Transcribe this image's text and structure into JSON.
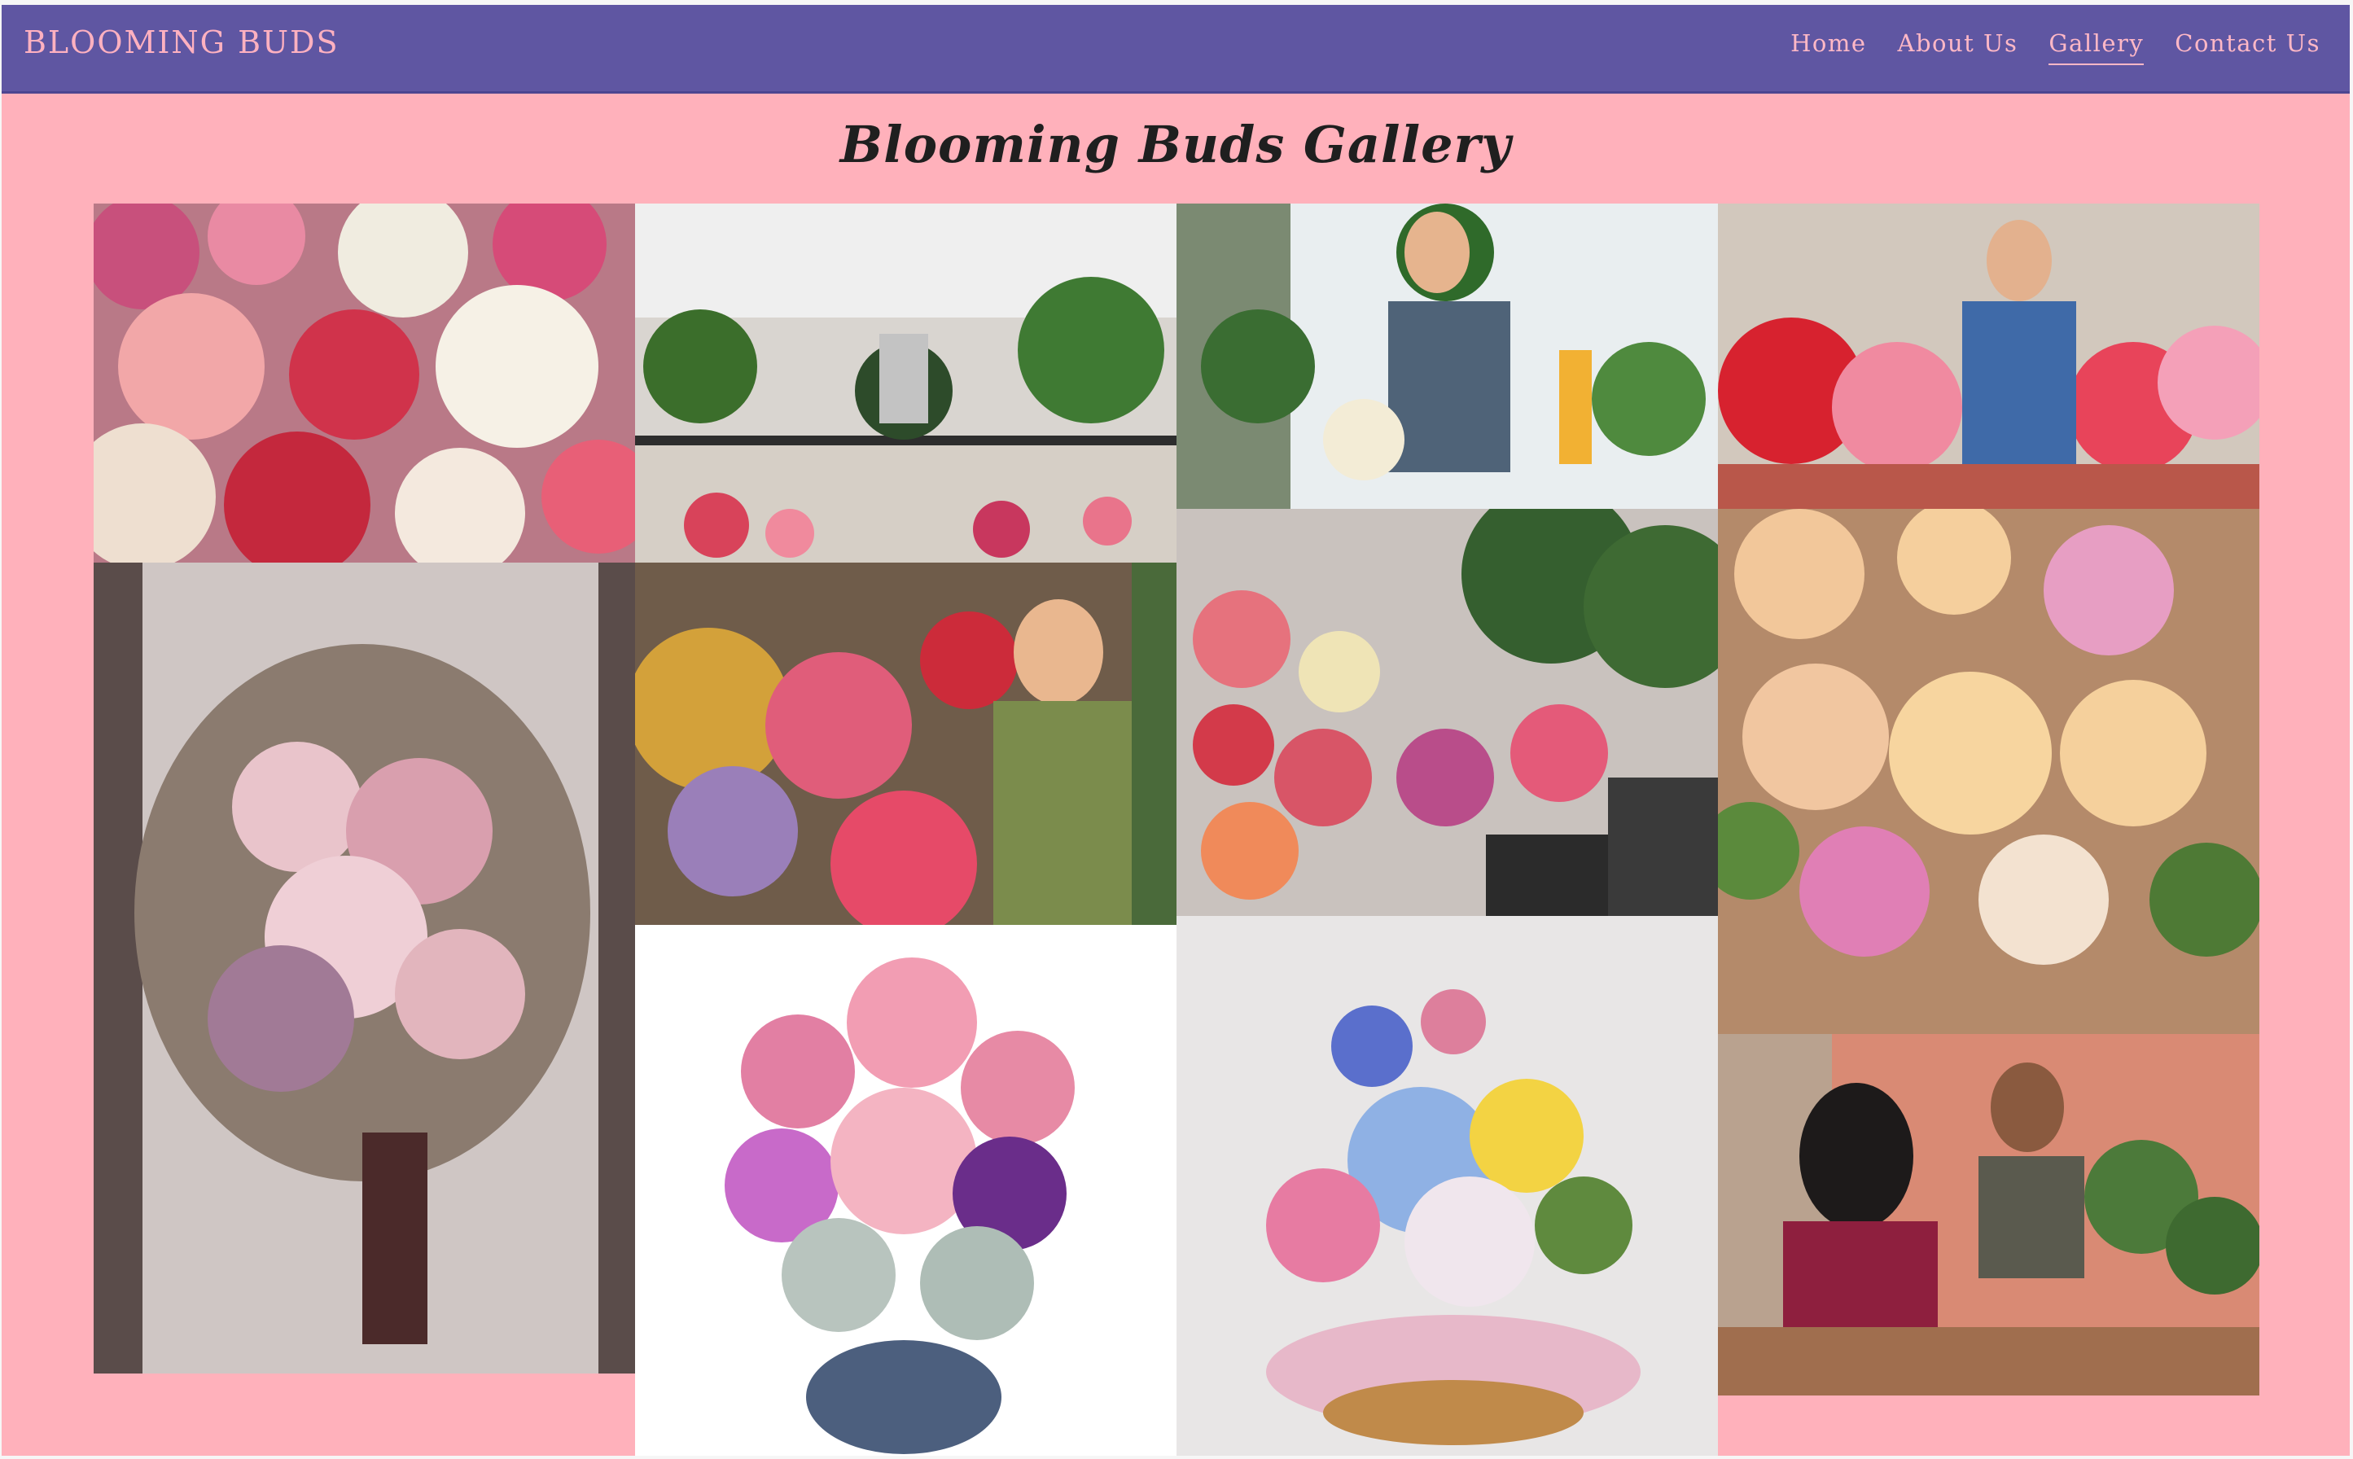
{
  "header": {
    "brand": "BLOOMING BUDS",
    "nav": [
      {
        "label": "Home",
        "active": false
      },
      {
        "label": "About Us",
        "active": false
      },
      {
        "label": "Gallery",
        "active": true
      },
      {
        "label": "Contact Us",
        "active": false
      }
    ]
  },
  "main": {
    "title": "Blooming Buds Gallery"
  },
  "colors": {
    "navbar": "#5f56a2",
    "page_background": "#ffb1bb",
    "brand_text": "#ffb1c0"
  },
  "gallery": {
    "photos": [
      {
        "name": "flower-market-photo"
      },
      {
        "name": "florist-shop-counter-photo"
      },
      {
        "name": "florist-on-phone-photo"
      },
      {
        "name": "florist-man-with-flowers-photo"
      },
      {
        "name": "bridal-bouquet-photo"
      },
      {
        "name": "florist-woman-with-roses-photo"
      },
      {
        "name": "flower-shop-display-photo"
      },
      {
        "name": "peach-roses-bouquet-photo"
      },
      {
        "name": "pink-arrangement-vase-photo"
      },
      {
        "name": "basket-arrangement-photo"
      },
      {
        "name": "customer-paying-florist-photo"
      }
    ]
  }
}
